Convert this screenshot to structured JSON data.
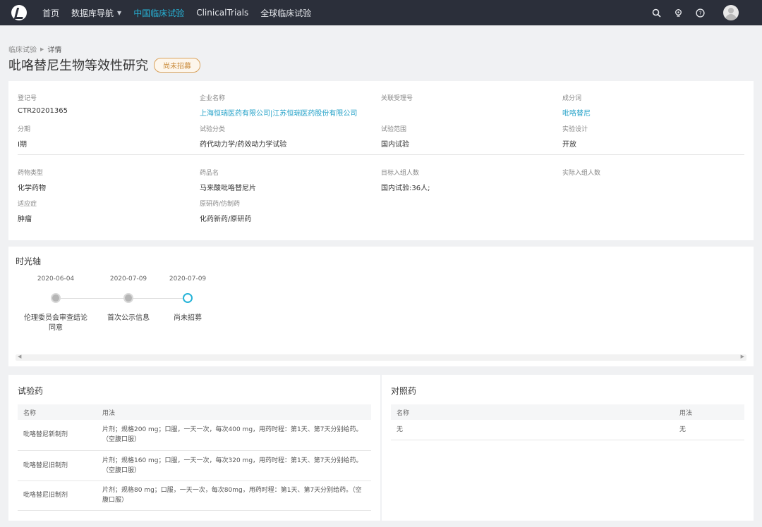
{
  "nav": {
    "items": [
      "首页",
      "数据库导航",
      "中国临床试验",
      "ClinicalTrials",
      "全球临床试验"
    ],
    "active_color": "#27b4d8",
    "icons": [
      "search-icon",
      "bulb-icon",
      "help-icon",
      "user-avatar-icon"
    ]
  },
  "breadcrumb": {
    "parent": "临床试验",
    "current": "详情"
  },
  "title": "吡咯替尼生物等效性研究",
  "status_badge": "尚未招募",
  "info": {
    "reg_no": {
      "label": "登记号",
      "value": "CTR20201365"
    },
    "company": {
      "label": "企业名称",
      "value": "上海恒瑞医药有限公司|江苏恒瑞医药股份有限公司"
    },
    "related_no": {
      "label": "关联受理号",
      "value": ""
    },
    "ingredient": {
      "label": "成分词",
      "value": "吡咯替尼"
    },
    "phase": {
      "label": "分期",
      "value": "I期"
    },
    "category": {
      "label": "试验分类",
      "value": "药代动力学/药效动力学试验"
    },
    "scope": {
      "label": "试验范围",
      "value": "国内试验"
    },
    "design": {
      "label": "实验设计",
      "value": "开放"
    },
    "drug_type": {
      "label": "药物类型",
      "value": "化学药物"
    },
    "drug_name": {
      "label": "药品名",
      "value": "马来酸吡咯替尼片"
    },
    "target_enroll": {
      "label": "目标入组人数",
      "value": "国内试验:36人;"
    },
    "actual_enroll": {
      "label": "实际入组人数",
      "value": ""
    },
    "indication": {
      "label": "适应症",
      "value": "肿瘤"
    },
    "origin": {
      "label": "原研药/仿制药",
      "value": "化药新药/原研药"
    }
  },
  "timeline": {
    "title": "时光轴",
    "events": [
      {
        "date": "2020-06-04",
        "label": "伦理委员会审查结论同意",
        "current": false
      },
      {
        "date": "2020-07-09",
        "label": "首次公示信息",
        "current": false
      },
      {
        "date": "2020-07-09",
        "label": "尚未招募",
        "current": true
      }
    ]
  },
  "test_drug": {
    "title": "试验药",
    "columns": [
      "名称",
      "用法"
    ],
    "rows": [
      {
        "name": "吡咯替尼新制剂",
        "usage": "片剂；规格200 mg；口服，一天一次，每次400 mg，用药时程：第1天、第7天分别给药。（空腹口服）"
      },
      {
        "name": "吡咯替尼旧制剂",
        "usage": "片剂；规格160 mg；口服，一天一次，每次320 mg，用药时程：第1天、第7天分别给药。（空腹口服）"
      },
      {
        "name": "吡咯替尼旧制剂",
        "usage": "片剂；规格80 mg；口服，一天一次，每次80mg，用药时程：第1天、第7天分别给药。（空腹口服）"
      }
    ]
  },
  "control_drug": {
    "title": "对照药",
    "columns": [
      "名称",
      "用法"
    ],
    "rows": [
      {
        "name": "无",
        "usage": "无"
      }
    ]
  }
}
